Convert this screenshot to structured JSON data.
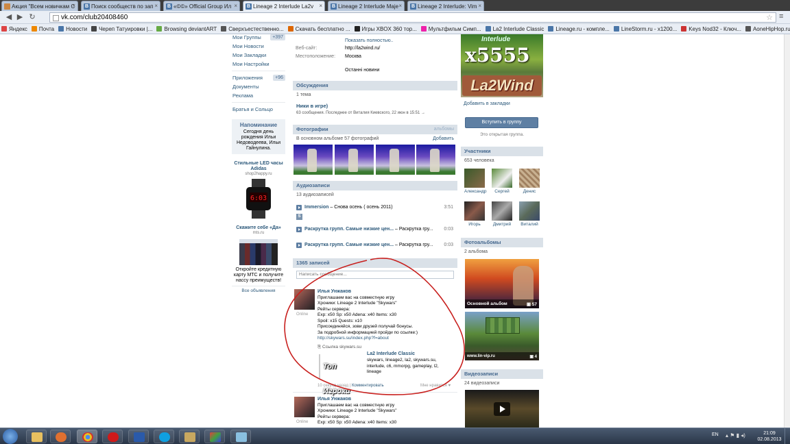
{
  "tabs": [
    {
      "label": "Акция \"Всем новичкам С"
    },
    {
      "label": "Поиск сообществ по зап"
    },
    {
      "label": "«©©» Official Group Ил"
    },
    {
      "label": "Lineage 2 Interlude La2v"
    },
    {
      "label": "Lineage 2 Interlude Maje"
    },
    {
      "label": "Lineage 2 Interlude: Vim"
    }
  ],
  "url": "vk.com/club20408460",
  "bookmarks": [
    "Яндекс",
    "Почта",
    "Новости",
    "Череп Татуировки |...",
    "Browsing deviantART",
    "Сверхъестественно...",
    "Скачать бесплатно ...",
    "Игры XBOX 360 тор...",
    "Мультфильм Симп...",
    "La2 Interlude Classic",
    "Lineage.ru - компле...",
    "LineStorm.ru - x1200...",
    "Keys Nod32 - Ключ...",
    "AoneHipHop.ru: Яр..."
  ],
  "left_menu": {
    "items": [
      {
        "label": "Мои Группы",
        "count": "+397"
      },
      {
        "label": "Мои Новости"
      },
      {
        "label": "Мои Закладки"
      },
      {
        "label": "Мои Настройки"
      }
    ],
    "items2": [
      {
        "label": "Приложения",
        "count": "+96"
      },
      {
        "label": "Документы"
      },
      {
        "label": "Реклама"
      }
    ],
    "item3": "Братья и Сольцо",
    "reminder_title": "Напоминание",
    "reminder_text": "Сегодня день рождения Ильи Недоводеева, Ильи Гайнулина.",
    "ad1_title": "Стильные LED часы Adidas",
    "ad1_site": "shop2happy.ru",
    "ad2_title": "Скажите себе «Да»",
    "ad2_site": "mts.ru",
    "ad2_text": "Откройте кредитную карту МТС и получите нассу преимуществ!",
    "all_ads": "Все объявления"
  },
  "info": {
    "more_link": "Показать полностью..",
    "website_label": "Веб-сайт:",
    "website_value": "http://la2wind.ru/",
    "location_label": "Местоположение:",
    "location_value": "Москва",
    "latest_news": "Останні новини"
  },
  "discussions": {
    "title": "Обсуждения",
    "count": "1 тема",
    "topic": "Ники в игре)",
    "meta": "63 сообщения. Последнее от Виталия Киевского, 22 июн в 15:51"
  },
  "photos": {
    "title": "Фотографии",
    "albums_link": "альбомы",
    "count": "В основном альбоме 57 фотографий",
    "add": "Добавить"
  },
  "audio": {
    "title": "Аудиозаписи",
    "count": "13 аудиозаписей",
    "tracks": [
      {
        "artist": "Immersion",
        "title": " – Снова осень ( осень 2011)",
        "duration": "3:51"
      },
      {
        "artist": "Раскрутка групп. Самые низкие цен...",
        "title": " – Раскрутка гру...",
        "duration": "0:03"
      },
      {
        "artist": "Раскрутка групп. Самые низкие цен...",
        "title": " – Раскрутка гру...",
        "duration": "0:03"
      }
    ],
    "badge": "S"
  },
  "wall": {
    "title": "1365 записей",
    "placeholder": "Написать сообщение..."
  },
  "post1": {
    "author": "Илья Унжаков",
    "online": "Online",
    "lines": [
      "Приглашаем вас на совместную игру",
      "Хроники: Lineage 2 Interlude \"Skywars\"",
      "Рейты сервера:",
      "Exp: x50 Sp: x50 Adena: x40 Items: x30",
      "Spoil: x15 Quests: x10",
      "Присоединяйся, зови друзей получай бонусы.",
      "За подробной информацией пройди по ссылке:)"
    ],
    "link": "http://skywars.su/index.php?f=about",
    "link_caption": "Ссылка skywars.su",
    "card_title": "La2 Interlude Classic",
    "card_text": "skywars, lineage2, la2, skywars.su, interlude, c6, mmorpg, gameplay, l2, lineage",
    "thumb_text": "Топ Игроки",
    "time": "10 секунд назад",
    "comment": "Комментировать",
    "like": "Мне нравится"
  },
  "post2": {
    "author": "Илья Унжаков",
    "online": "Online",
    "lines": [
      "Приглашаем вас на совместную игру",
      "Хроники: Lineage 2 Interlude \"Skywars\"",
      "Рейты сервера:",
      "Exp: x50 Sp: x50 Adena: x40 Items: x30"
    ]
  },
  "right": {
    "banner_top": "Interlude",
    "banner_rate": "x5555",
    "banner_logo": "La2Wind",
    "bookmark": "Добавить в закладки",
    "join": "Вступить в группу",
    "open_group": "Это открытая группа.",
    "members_title": "Участники",
    "members_count": "653 человека",
    "members": [
      "Александр",
      "Сергей",
      "Денис",
      "Игорь",
      "Дмитрий",
      "Виталий"
    ],
    "albums_title": "Фотоальбомы",
    "albums_count": "2 альбома",
    "album1_name": "Основной альбом",
    "album1_count": "57",
    "album2_site": "www.lin-vip.ru",
    "album2_count": "4",
    "video_title": "Видеозаписи",
    "video_count": "24 видеозаписи"
  },
  "taskbar": {
    "lang": "EN",
    "time": "21:09",
    "date": "02.08.2013"
  },
  "colors": {
    "vk_blue": "#45688e",
    "link": "#2b587a",
    "annotation": "#c8201e"
  }
}
